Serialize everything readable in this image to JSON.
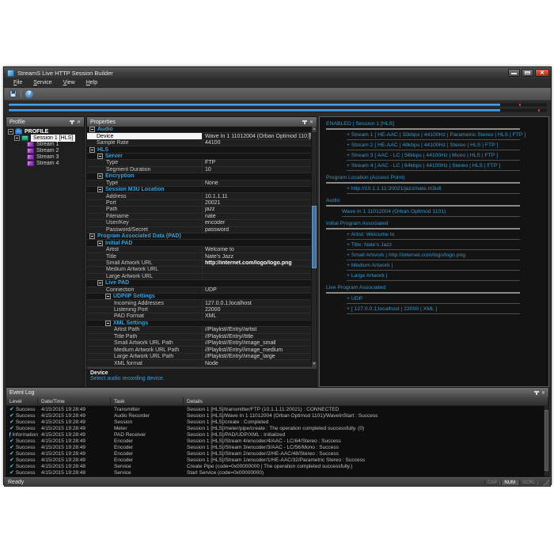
{
  "window": {
    "title": "StreamS Live HTTP Session Builder"
  },
  "menu": {
    "items": [
      "File",
      "Service",
      "View",
      "Help"
    ]
  },
  "toolbar": {
    "icons": [
      "save-icon",
      "help-icon"
    ]
  },
  "meters": {
    "fill_percent": 91.5,
    "peak_percents": [
      95.0,
      98.6
    ]
  },
  "profile": {
    "title": "Profile",
    "root": "PROFILE",
    "session": "Session 1 [HLS]",
    "streams": [
      "Stream 1",
      "Stream 2",
      "Stream 3",
      "Stream 4"
    ]
  },
  "properties": {
    "title": "Properties",
    "rows": [
      {
        "t": "cat",
        "lvl": 0,
        "label": "Audio"
      },
      {
        "t": "item",
        "lvl": 0,
        "label": "Device",
        "value": "Wave In 1 11012004 (Orban Optimod 1101)",
        "selected": true,
        "combo": true
      },
      {
        "t": "item",
        "lvl": 0,
        "label": "Sample Rate",
        "value": "44100"
      },
      {
        "t": "cat",
        "lvl": 0,
        "label": "HLS"
      },
      {
        "t": "cat",
        "lvl": 1,
        "label": "Server"
      },
      {
        "t": "item",
        "lvl": 1,
        "label": "Type",
        "value": "FTP"
      },
      {
        "t": "item",
        "lvl": 1,
        "label": "Segment Duration",
        "value": "10"
      },
      {
        "t": "cat",
        "lvl": 1,
        "label": "Encryption"
      },
      {
        "t": "item",
        "lvl": 1,
        "label": "Type",
        "value": "None"
      },
      {
        "t": "cat",
        "lvl": 1,
        "label": "Session M3U Location"
      },
      {
        "t": "item",
        "lvl": 1,
        "label": "Address",
        "value": "10.1.1.11"
      },
      {
        "t": "item",
        "lvl": 1,
        "label": "Port",
        "value": "20021"
      },
      {
        "t": "item",
        "lvl": 1,
        "label": "Path",
        "value": "jazz"
      },
      {
        "t": "item",
        "lvl": 1,
        "label": "Filename",
        "value": "nate"
      },
      {
        "t": "item",
        "lvl": 1,
        "label": "User/Key",
        "value": "encoder"
      },
      {
        "t": "item",
        "lvl": 1,
        "label": "Password/Secret",
        "value": "password"
      },
      {
        "t": "cat",
        "lvl": 0,
        "label": "Program Associated Data (PAD)"
      },
      {
        "t": "cat",
        "lvl": 1,
        "label": "Initial PAD"
      },
      {
        "t": "item",
        "lvl": 1,
        "label": "Artist",
        "value": "Welcome to"
      },
      {
        "t": "item",
        "lvl": 1,
        "label": "Title",
        "value": "Nate's Jazz"
      },
      {
        "t": "item",
        "lvl": 1,
        "label": "Small Artwork URL",
        "value": "http://internet.com/logo/logo.png",
        "bold": true
      },
      {
        "t": "item",
        "lvl": 1,
        "label": "Medium Artwork URL",
        "value": ""
      },
      {
        "t": "item",
        "lvl": 1,
        "label": "Large Artwork URL",
        "value": ""
      },
      {
        "t": "cat",
        "lvl": 1,
        "label": "Live PAD"
      },
      {
        "t": "item",
        "lvl": 1,
        "label": "Connection",
        "value": "UDP"
      },
      {
        "t": "cat",
        "lvl": 2,
        "label": "UDP/IP Settings"
      },
      {
        "t": "item",
        "lvl": 2,
        "label": "Incoming Addresses",
        "value": "127.0.0.1;localhost"
      },
      {
        "t": "item",
        "lvl": 2,
        "label": "Listening Port",
        "value": "22000"
      },
      {
        "t": "item",
        "lvl": 2,
        "label": "PAD Format",
        "value": "XML"
      },
      {
        "t": "cat",
        "lvl": 2,
        "label": "XML Settings"
      },
      {
        "t": "item",
        "lvl": 2,
        "label": "Artist Path",
        "value": "//Playlist//Entry//artist"
      },
      {
        "t": "item",
        "lvl": 2,
        "label": "Title Path",
        "value": "//Playlist//Entry//title"
      },
      {
        "t": "item",
        "lvl": 2,
        "label": "Small Artwork URL Path",
        "value": "//Playlist//Entry//image_small"
      },
      {
        "t": "item",
        "lvl": 2,
        "label": "Medium Artwork URL Path",
        "value": "//Playlist//Entry//image_medium"
      },
      {
        "t": "item",
        "lvl": 2,
        "label": "Large Artwork URL Path",
        "value": "//Playlist//Entry//image_large"
      },
      {
        "t": "item",
        "lvl": 2,
        "label": "XML format",
        "value": "Node"
      }
    ],
    "description_title": "Device",
    "description_text": "Select audio recording device."
  },
  "summary": {
    "lines": [
      {
        "k": "header",
        "text": "ENABLED | Session 1 [HLS]"
      },
      {
        "k": "item",
        "text": "+ Stream 1 [ HE-AAC | 32kbps | 44100Hz | Parametric Stereo | HLS | FTP ]"
      },
      {
        "k": "item",
        "text": "+ Stream 2 [ HE-AAC | 48kbps | 44100Hz | Stereo | HLS | FTP ]"
      },
      {
        "k": "item",
        "text": "+ Stream 3 [ AAC - LC | 56kbps | 44100Hz | Mono | HLS | FTP ]"
      },
      {
        "k": "item",
        "text": "+ Stream 4 [ AAC - LC | 64kbps | 44100Hz | Stereo | HLS | FTP ]"
      },
      {
        "k": "header",
        "text": "Program Location (Access Point)"
      },
      {
        "k": "item",
        "text": "+ http://10.1.1.11:20021/jazz/nate.m3u8"
      },
      {
        "k": "header",
        "text": "Audio"
      },
      {
        "k": "item2",
        "text": "Wave In 1 11012004 (Orban Optimod 1101)"
      },
      {
        "k": "header",
        "text": "Initial Program Associated"
      },
      {
        "k": "item",
        "text": "+ Artist: Welcome to"
      },
      {
        "k": "item",
        "text": "+ Title: Nate's Jazz"
      },
      {
        "k": "item",
        "text": "+ Small Artwork | http://internet.com/logo/logo.png"
      },
      {
        "k": "item",
        "text": "+ Medium Artwork |"
      },
      {
        "k": "item",
        "text": "+ Large Artwork |"
      },
      {
        "k": "header",
        "text": "Live Program Associated"
      },
      {
        "k": "item",
        "text": "+ UDP"
      },
      {
        "k": "item",
        "text": "+ [ 127.0.0.1;localhost | 22000 | XML ]"
      }
    ]
  },
  "event_log": {
    "title": "Event Log",
    "columns": [
      "Level",
      "Date/Time",
      "Task",
      "Details"
    ],
    "rows": [
      {
        "level": "Success",
        "date": "4/15/2015 19:28:49",
        "task": "Transmitter",
        "details": "Session 1 [HLS]/transmitter/FTP (10.1.1.11:20021) : CONNECTED"
      },
      {
        "level": "Success",
        "date": "4/15/2015 19:28:49",
        "task": "Audio Recorder",
        "details": "Session 1 [HLS]/Wave In 1 11012004 (Orban Optimod 1101)/WaveInStart : Success"
      },
      {
        "level": "Success",
        "date": "4/15/2015 19:28:49",
        "task": "Session",
        "details": "Session 1 [HLS]/create : Completed"
      },
      {
        "level": "Success",
        "date": "4/15/2015 19:28:49",
        "task": "Meter",
        "details": "Session 1 [HLS]/meter/pipe/create : The operation completed successfully. (0)"
      },
      {
        "level": "Information",
        "date": "4/15/2015 19:28:49",
        "task": "PAD Receiver",
        "details": "Session 1 [HLS]/PAD/UDP/XML : Initialized"
      },
      {
        "level": "Success",
        "date": "4/15/2015 19:28:49",
        "task": "Encoder",
        "details": "Session 1 [HLS]/Stream 4/encoder/4/AAC - LC/64/Stereo : Success"
      },
      {
        "level": "Success",
        "date": "4/15/2015 19:28:49",
        "task": "Encoder",
        "details": "Session 1 [HLS]/Stream 3/encoder/3/AAC - LC/56/Mono : Success"
      },
      {
        "level": "Success",
        "date": "4/15/2015 19:28:49",
        "task": "Encoder",
        "details": "Session 1 [HLS]/Stream 2/encoder/2/HE-AAC/48/Stereo : Success"
      },
      {
        "level": "Success",
        "date": "4/15/2015 19:28:49",
        "task": "Encoder",
        "details": "Session 1 [HLS]/Stream 1/encoder/1/HE-AAC/32/Parametric Stereo : Success"
      },
      {
        "level": "Success",
        "date": "4/15/2015 19:28:48",
        "task": "Service",
        "details": "Create Pipe (code=0x00000000 | The operation completed successfully.)"
      },
      {
        "level": "Success",
        "date": "4/15/2015 19:28:48",
        "task": "Service",
        "details": "Start Service (code=0x00000000)"
      }
    ]
  },
  "status": {
    "ready": "Ready",
    "locks": [
      {
        "label": "CAP",
        "active": false
      },
      {
        "label": "NUM",
        "active": true
      },
      {
        "label": "SCRL",
        "active": false
      }
    ]
  },
  "colors": {
    "accent_cyan": "#3da0d6",
    "summary_blue": "#3595cc",
    "meter_blue": "#1a6fc8",
    "peak_red": "#cf3226",
    "success_check": "#49c6e4",
    "info_blue": "#2f6fd8",
    "close_red": "#a62b1a"
  }
}
